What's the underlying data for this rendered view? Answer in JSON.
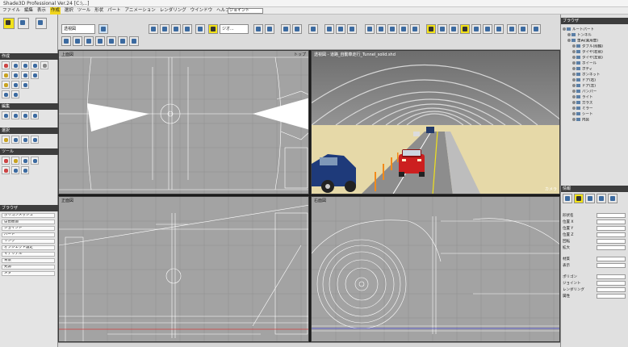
{
  "window": {
    "title": "Shade3D Professional Ver.24 [C:\\...]"
  },
  "menu": {
    "items": [
      "ファイル",
      "編集",
      "表示",
      "作成",
      "選択",
      "ツール",
      "形状",
      "パート",
      "アニメーション",
      "レンダリング",
      "ウインドウ",
      "ヘルプ"
    ],
    "selected_index": 3,
    "field_value": "ジョイント"
  },
  "toolbar": {
    "view_dropdown": "透視図",
    "mode_dropdown": "ジオ..."
  },
  "left_panel": {
    "header_create": "作成",
    "header_edit": "編集",
    "header_selection": "選択",
    "header_tools": "ツール",
    "list_header": "ブラウザ",
    "list_items": [
      "ポリゴンメッシュ",
      "自由曲面",
      "ジョイント",
      "パート",
      "リンク",
      "オブジェクト設定",
      "マテリアル",
      "背景",
      "光源",
      "メタ"
    ]
  },
  "right_panel": {
    "header_browser": "ブラウザ",
    "tree": [
      "ルートパート",
      "トンネル",
      "車両(乗用車)",
      "ダブル(前輪)",
      "タイヤ(右前)",
      "タイヤ(左前)",
      "ホイール",
      "ボディ",
      "ボンネット",
      "ドア(右)",
      "ドア(左)",
      "バンパー",
      "ライト",
      "ガラス",
      "ミラー",
      "シート",
      "内装"
    ],
    "header_info": "情報",
    "props": [
      "形状名",
      "位置 X",
      "位置 Y",
      "位置 Z",
      "回転",
      "拡大",
      "材質",
      "表示",
      "ポリゴン",
      "ジョイント",
      "レンダリング",
      "属性"
    ]
  },
  "viewports": {
    "top_left": {
      "label": "上面図",
      "label_right": "トップ"
    },
    "top_right": {
      "label": "透視図 - 道路_自動車走行_Tunnel_solid.shd",
      "label_right": "カメラ"
    },
    "bottom_left": {
      "label": "正面図",
      "label_right": ""
    },
    "bottom_right": {
      "label": "右面図",
      "label_right": ""
    }
  },
  "colors": {
    "viewport_bg": "#a3a3a3",
    "wire": "#ffffff",
    "accent_yellow": "#f2e21a",
    "tunnel_wall": "#e6d9a8",
    "car_red": "#cc1f1f",
    "car_blue": "#1e3a7a"
  }
}
